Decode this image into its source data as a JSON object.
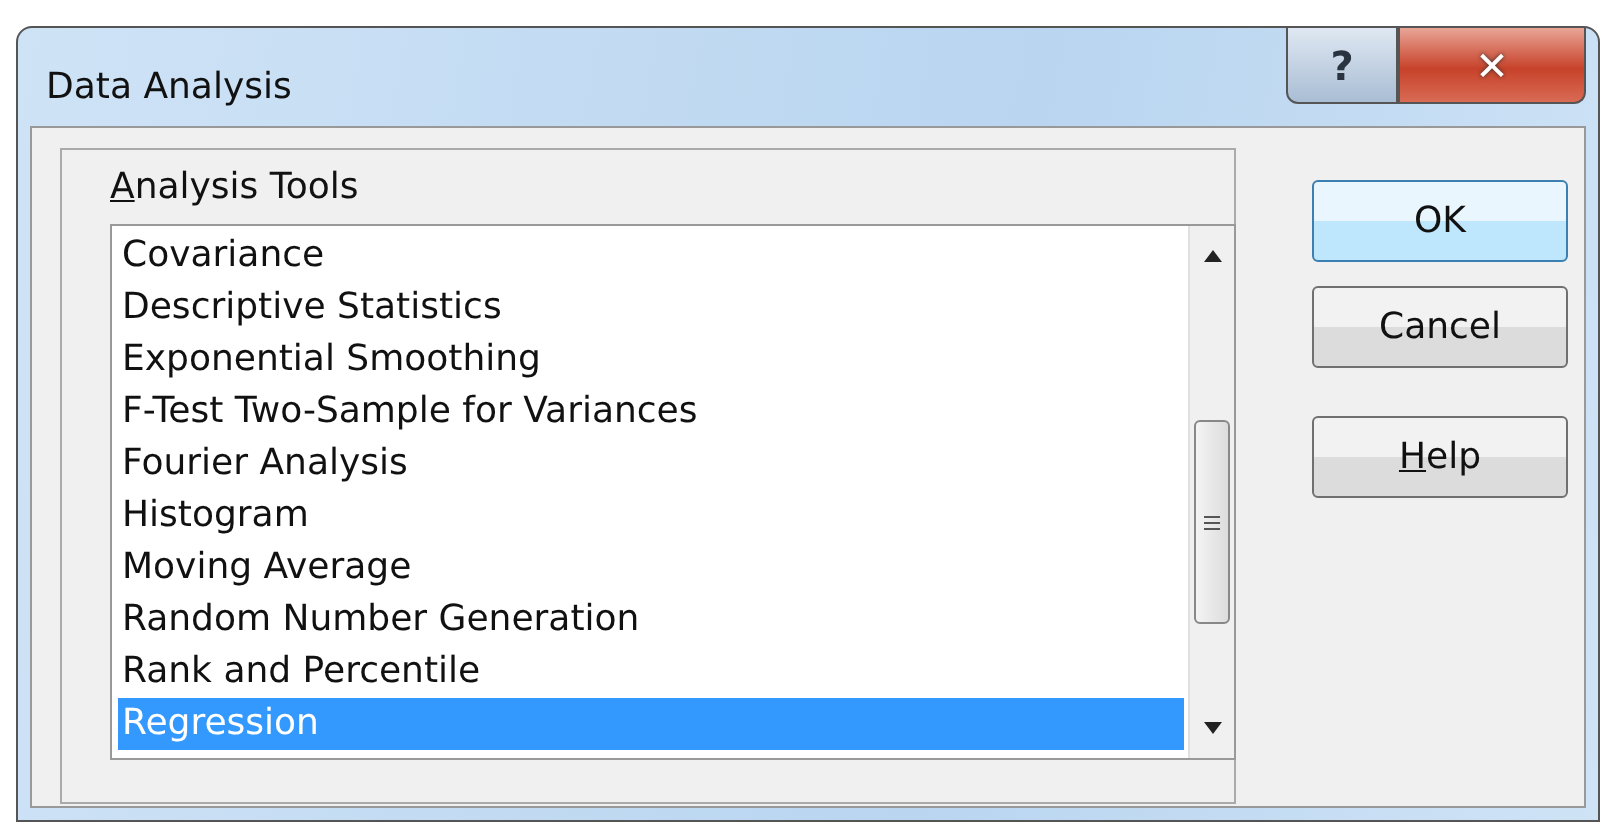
{
  "window": {
    "title": "Data Analysis",
    "help_button": "?",
    "close_button": "✕"
  },
  "analysis_tools": {
    "label": "Analysis Tools",
    "mnemonic_first": true,
    "items": [
      {
        "label": "Covariance",
        "selected": false
      },
      {
        "label": "Descriptive Statistics",
        "selected": false
      },
      {
        "label": "Exponential Smoothing",
        "selected": false
      },
      {
        "label": "F-Test Two-Sample for Variances",
        "selected": false
      },
      {
        "label": "Fourier Analysis",
        "selected": false
      },
      {
        "label": "Histogram",
        "selected": false
      },
      {
        "label": "Moving Average",
        "selected": false
      },
      {
        "label": "Random Number Generation",
        "selected": false
      },
      {
        "label": "Rank and Percentile",
        "selected": false
      },
      {
        "label": "Regression",
        "selected": true
      }
    ]
  },
  "buttons": [
    {
      "label": "OK",
      "default": true,
      "mnemonic_first": false
    },
    {
      "label": "Cancel",
      "default": false,
      "mnemonic_first": false
    },
    {
      "label": "Help",
      "default": false,
      "mnemonic_first": true
    }
  ]
}
